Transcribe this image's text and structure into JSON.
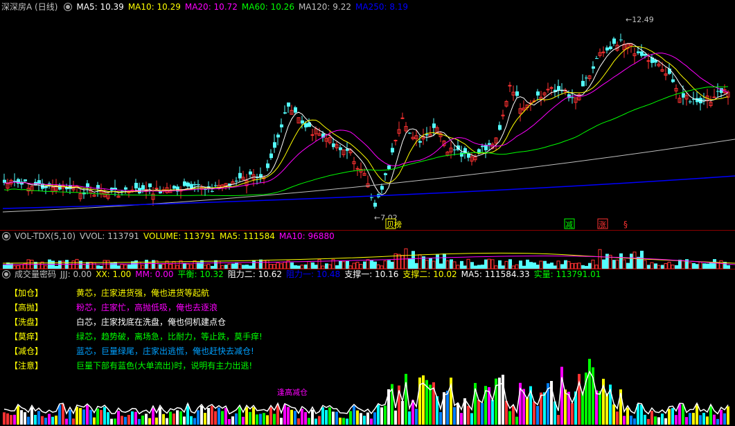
{
  "main": {
    "title": "深深房A (日线)",
    "ma": [
      {
        "label": "MA5: 10.39",
        "color": "#ffffff"
      },
      {
        "label": "MA10: 10.29",
        "color": "#ffff00"
      },
      {
        "label": "MA20: 10.72",
        "color": "#ff00ff"
      },
      {
        "label": "MA60: 10.26",
        "color": "#00ff00"
      },
      {
        "label": "MA120: 9.22",
        "color": "#c0c0c0"
      },
      {
        "label": "MA250: 8.19",
        "color": "#0000ff"
      }
    ],
    "high_label": "12.49",
    "low_label": "7.02",
    "signals": {
      "buy": "贝榜",
      "reduce": "减",
      "rise": "涨",
      "sym": "§"
    }
  },
  "volume": {
    "title": "VOL-TDX(5,10)",
    "items": [
      {
        "label": "VVOL: 113791",
        "color": "#c0c0c0"
      },
      {
        "label": "VOLUME: 113791",
        "color": "#ffff00"
      },
      {
        "label": "MA5: 111584",
        "color": "#ffff00"
      },
      {
        "label": "MA10: 96880",
        "color": "#ff00ff"
      }
    ]
  },
  "indicator": {
    "title": "成交量密码",
    "items": [
      {
        "label": "JJJ: 0.00",
        "color": "#c0c0c0"
      },
      {
        "label": "XX: 1.00",
        "color": "#ffff00"
      },
      {
        "label": "MM: 0.00",
        "color": "#ff00ff"
      },
      {
        "label": "平衡: 10.32",
        "color": "#00ff00"
      },
      {
        "label": "阻力二: 10.62",
        "color": "#ffffff"
      },
      {
        "label": "阻力一: 10.48",
        "color": "#0000ff"
      },
      {
        "label": "支撑一: 10.16",
        "color": "#ffffff"
      },
      {
        "label": "支撑二: 10.02",
        "color": "#ffff00"
      },
      {
        "label": "MA5: 111584.33",
        "color": "#ffffff"
      },
      {
        "label": "实量: 113791.01",
        "color": "#00ff00"
      }
    ],
    "legend": [
      {
        "key": "【加仓】",
        "text": "黄芯，庄家进货强，俺也进货等起航",
        "color": "#ffff00"
      },
      {
        "key": "【高抛】",
        "text": "粉芯，庄家忙，高抛低吸，俺也去逐浪",
        "color": "#ff00ff"
      },
      {
        "key": "【洗盘】",
        "text": "白芯，庄家找底在洗盘，俺也伺机建点仓",
        "color": "#ffffff"
      },
      {
        "key": "【莫痒】",
        "text": "绿芯，趋势破，离场急，比耐力，等止跌，莫手痒!",
        "color": "#00ff00"
      },
      {
        "key": "【减仓】",
        "text": "蓝芯，巨量绿尾，庄家出逃慌，俺也赶快去减仓!",
        "color": "#00a0ff"
      },
      {
        "key": "【注意】",
        "text": "巨量下部有蓝色(大单流出)时，说明有主力出逃!",
        "color": "#00ff00"
      }
    ],
    "watermark": "逢高减仓"
  }
}
